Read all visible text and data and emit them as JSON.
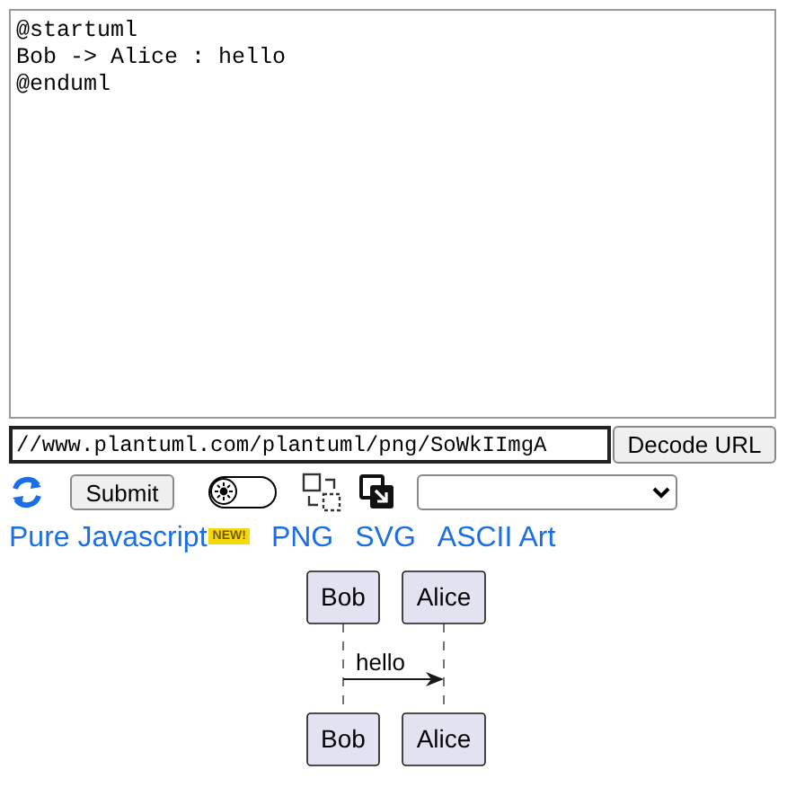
{
  "editor": {
    "value": "@startuml\nBob -> Alice : hello\n@enduml"
  },
  "url_field": {
    "value": "//www.plantuml.com/plantuml/png/SoWkIImgA"
  },
  "decode_button": "Decode URL",
  "submit_button": "Submit",
  "theme_toggle": {
    "on": false
  },
  "links": [
    {
      "label": "Pure Javascript",
      "badge": "NEW!"
    },
    {
      "label": "PNG"
    },
    {
      "label": "SVG"
    },
    {
      "label": "ASCII Art"
    }
  ],
  "diagram": {
    "participants_top": [
      "Bob",
      "Alice"
    ],
    "participants_bottom": [
      "Bob",
      "Alice"
    ],
    "message": {
      "label": "hello"
    }
  }
}
